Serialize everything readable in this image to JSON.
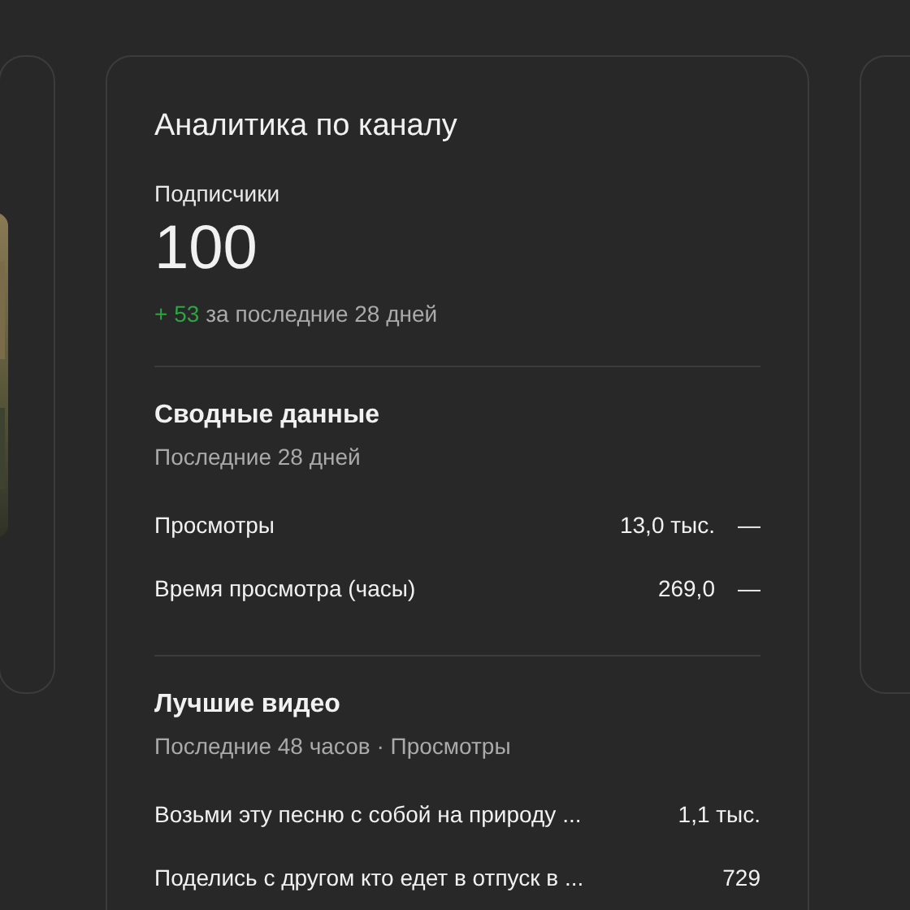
{
  "analytics": {
    "title": "Аналитика по каналу",
    "subscribers": {
      "label": "Подписчики",
      "value": "100",
      "change": "+ 53",
      "change_period": "за последние 28 дней"
    },
    "summary": {
      "title": "Сводные данные",
      "subtitle": "Последние 28 дней",
      "rows": [
        {
          "label": "Просмотры",
          "value": "13,0 тыс.",
          "trend": "—"
        },
        {
          "label": "Время просмотра (часы)",
          "value": "269,0",
          "trend": "—"
        }
      ]
    },
    "top_videos": {
      "title": "Лучшие видео",
      "subtitle": "Последние 48 часов · Просмотры",
      "rows": [
        {
          "title": "Возьми эту песню с собой на природу ...",
          "views": "1,1 тыс."
        },
        {
          "title": "Поделись с другом кто едет в отпуск в ...",
          "views": "729"
        }
      ]
    }
  }
}
